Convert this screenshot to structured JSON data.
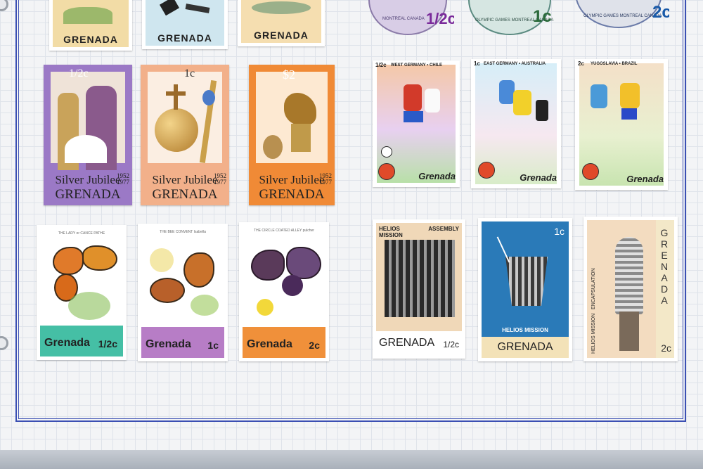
{
  "top_row": [
    {
      "country": "GRENADA",
      "bg": "#f2dca6"
    },
    {
      "country": "GRENADA",
      "bg": "#cfe6ef"
    },
    {
      "country": "GRENADA",
      "bg": "#f5deb0"
    }
  ],
  "top_olympic": [
    {
      "value": "1/2c",
      "caption": "MONTREAL CANADA"
    },
    {
      "value": "1c",
      "caption": "OLYMPIC GAMES MONTREAL CANADA"
    },
    {
      "value": "2c",
      "caption": "OLYMPIC GAMES MONTREAL CANADA"
    }
  ],
  "jubilee": [
    {
      "value": "1/2c",
      "title": "Silver Jubilee",
      "years": [
        "1952",
        "1977"
      ],
      "country": "GRENADA",
      "frame": "#9b79c6"
    },
    {
      "value": "1c",
      "title": "Silver Jubilee",
      "years": [
        "1952",
        "1977"
      ],
      "country": "GRENADA",
      "frame": "#f2b08a"
    },
    {
      "value": "$2",
      "title": "Silver Jubilee",
      "years": [
        "1952",
        "1977"
      ],
      "country": "GRENADA",
      "frame": "#f08a36"
    }
  ],
  "football": [
    {
      "value": "1/2c",
      "match": "WEST GERMANY • CHILE",
      "country": "Grenada",
      "bg": "#f3c6a8"
    },
    {
      "value": "1c",
      "match": "EAST GERMANY • AUSTRALIA",
      "country": "Grenada",
      "bg": "#cfe9f3"
    },
    {
      "value": "2c",
      "match": "YUGOSLAVIA • BRAZIL",
      "country": "Grenada",
      "bg": "#d7ecc0"
    }
  ],
  "butterflies": [
    {
      "value": "1/2c",
      "country": "Grenada",
      "band": "#45bfa5",
      "caption": "THE LADY or CANCE PATHE"
    },
    {
      "value": "1c",
      "country": "Grenada",
      "band": "#b77dc6",
      "caption": "THE BEE CONVENT Isabella"
    },
    {
      "value": "2c",
      "country": "Grenada",
      "band": "#f0903a",
      "caption": "THE CIRCLE COATED ALLEY pulcher"
    }
  ],
  "helios": [
    {
      "value": "1/2c",
      "label_left": "HELIOS MISSION",
      "label_right": "ASSEMBLY",
      "country": "GRENADA"
    },
    {
      "value": "1c",
      "label": "HELIOS MISSION",
      "country": "GRENADA"
    },
    {
      "value": "2c",
      "label": "HELIOS MISSION",
      "label2": "ENCAPSULATION",
      "country": "GRENADA"
    }
  ]
}
